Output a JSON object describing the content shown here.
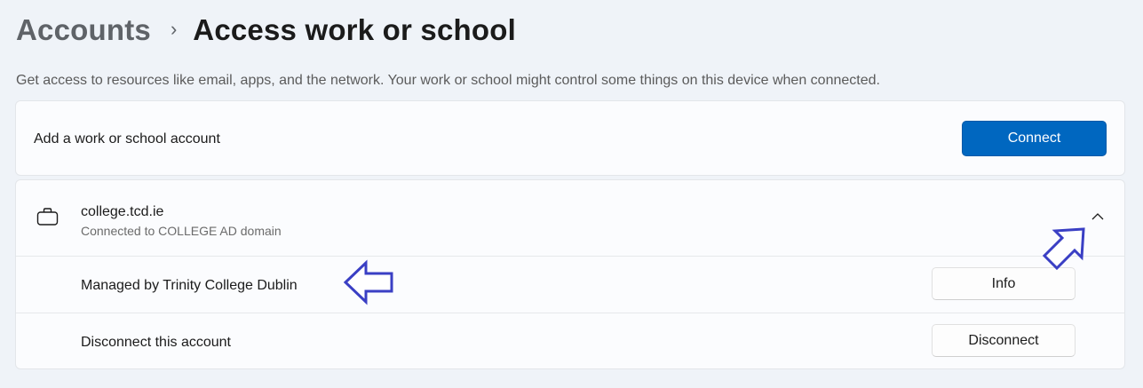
{
  "breadcrumb": {
    "parent": "Accounts",
    "separator": "›",
    "current": "Access work or school"
  },
  "description": "Get access to resources like email, apps, and the network. Your work or school might control some things on this device when connected.",
  "add_account": {
    "label": "Add a work or school account",
    "button_label": "Connect"
  },
  "account": {
    "icon": "briefcase-icon",
    "name": "college.tcd.ie",
    "status": "Connected to COLLEGE AD domain",
    "expand_icon": "chevron-up-icon",
    "rows": [
      {
        "label": "Managed by Trinity College Dublin",
        "button_label": "Info"
      },
      {
        "label": "Disconnect this account",
        "button_label": "Disconnect"
      }
    ]
  },
  "colors": {
    "background": "#eff3f8",
    "card": "#fbfcfe",
    "accent": "#0067c0",
    "annotation_arrow": "#3a3fc4"
  }
}
